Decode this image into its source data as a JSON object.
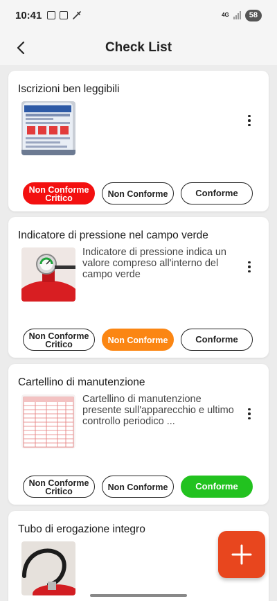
{
  "status_bar": {
    "time": "10:41",
    "network": "4G",
    "battery": "58"
  },
  "header": {
    "title": "Check List",
    "back_icon": "chevron-left-icon"
  },
  "items": [
    {
      "title": "Iscrizioni ben leggibili",
      "description": "",
      "image": "extinguisher-label-photo",
      "buttons": [
        "Non Conforme Critico",
        "Non Conforme",
        "Conforme"
      ],
      "selected": "Non Conforme Critico",
      "selected_color": "#f31010"
    },
    {
      "title": "Indicatore di pressione nel campo verde",
      "description": "Indicatore di pressione indica un valore compreso all'interno del campo verde",
      "image": "pressure-gauge-photo",
      "buttons": [
        "Non Conforme Critico",
        "Non Conforme",
        "Conforme"
      ],
      "selected": "Non Conforme",
      "selected_color": "#fb8613"
    },
    {
      "title": "Cartellino di manutenzione",
      "description": "Cartellino di manutenzione presente sull'apparecchio e ultimo controllo periodico ...",
      "image": "maintenance-tag-photo",
      "buttons": [
        "Non Conforme Critico",
        "Non Conforme",
        "Conforme"
      ],
      "selected": "Conforme",
      "selected_color": "#22c21f"
    },
    {
      "title": "Tubo di erogazione integro",
      "description": "",
      "image": "hose-photo"
    }
  ],
  "fab": {
    "icon": "plus-icon",
    "color": "#e8461e"
  }
}
